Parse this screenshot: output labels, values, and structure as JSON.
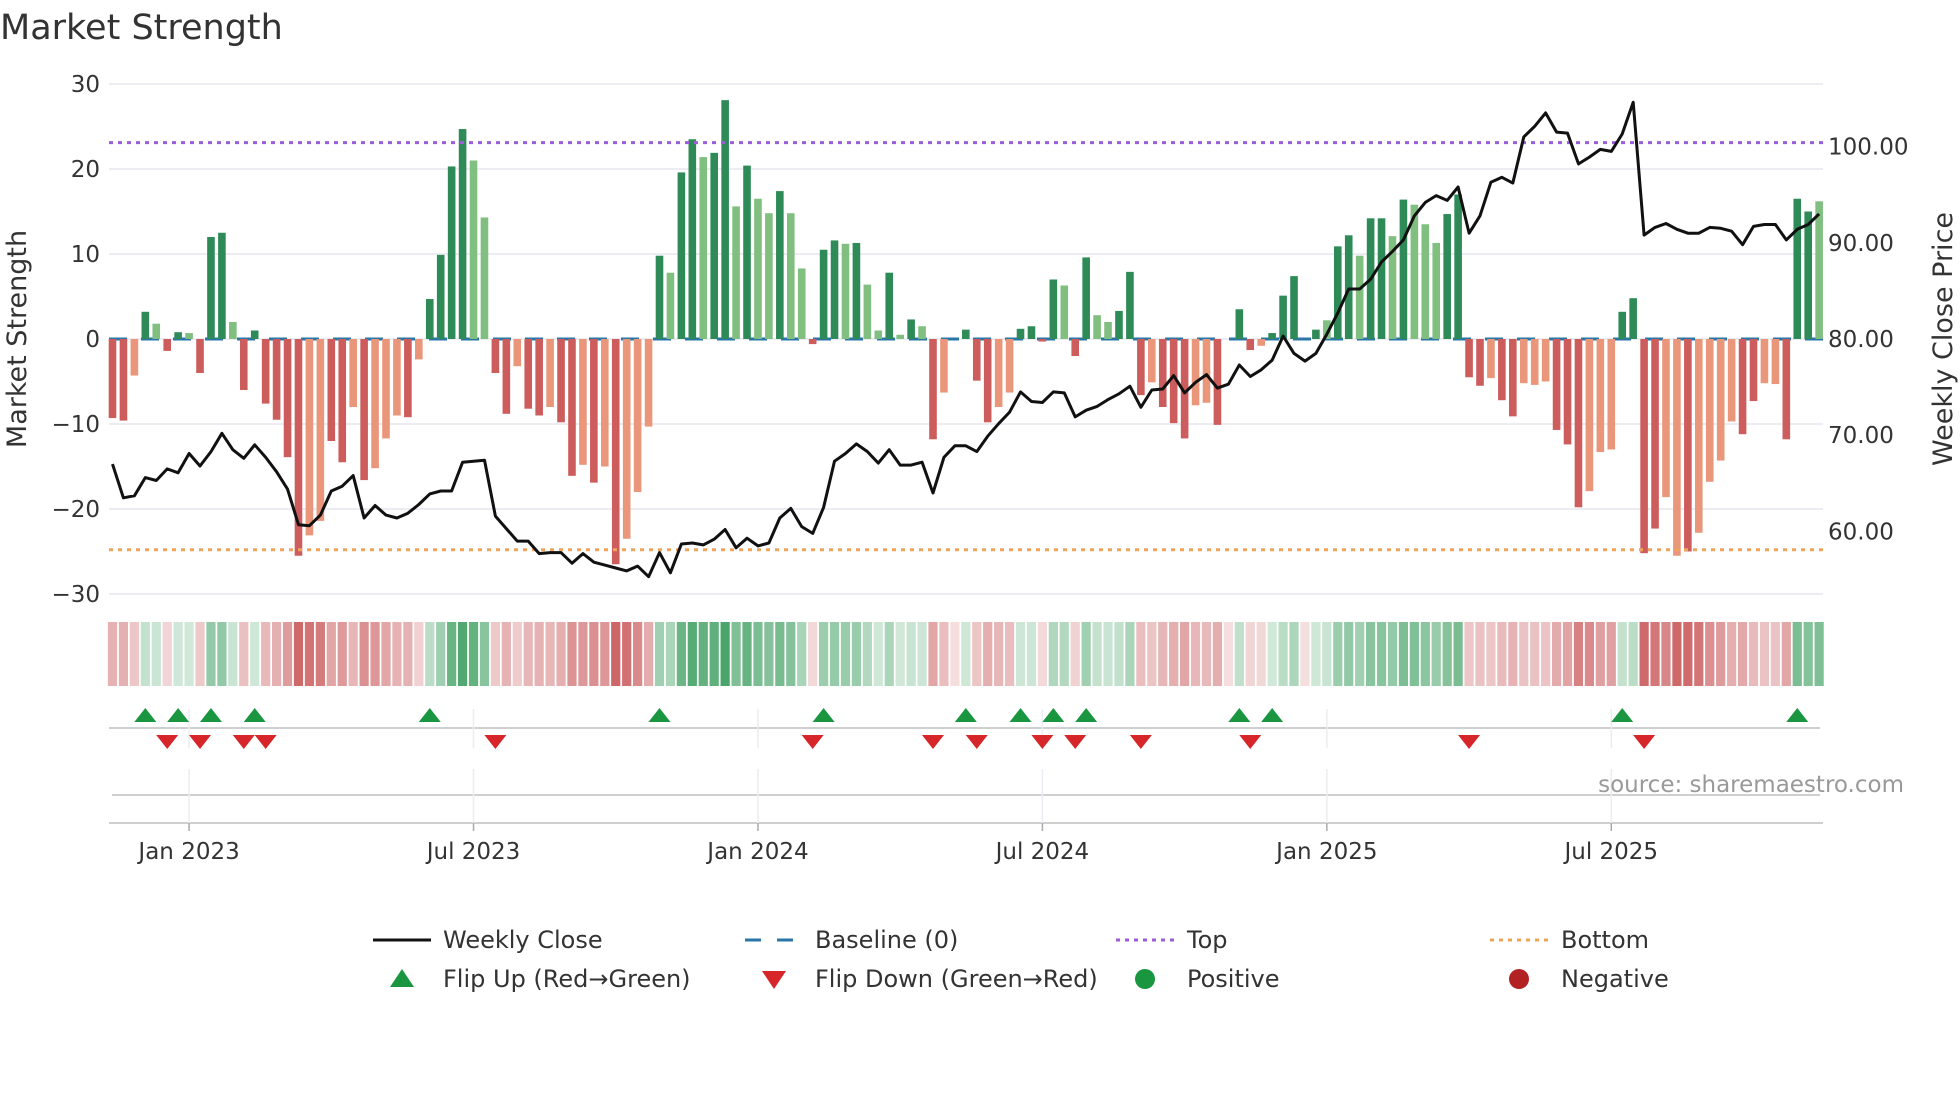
{
  "chart_data": {
    "type": "bar",
    "title": "Market Strength",
    "ylabel": "Market Strength",
    "y2label": "Weekly Close Price",
    "ylim": [
      -30,
      30
    ],
    "y2lim": [
      53.5,
      106.5
    ],
    "yticks": [
      "30",
      "20",
      "10",
      "0",
      "−10",
      "−20",
      "−30"
    ],
    "ytick_values": [
      30,
      20,
      10,
      0,
      -10,
      -20,
      -30
    ],
    "y2ticks": [
      "100.00",
      "90.00",
      "80.00",
      "70.00",
      "60.00"
    ],
    "y2tick_values": [
      100,
      90,
      80,
      70,
      60
    ],
    "xticks": [
      "Jan 2023",
      "Jul 2023",
      "Jan 2024",
      "Jul 2024",
      "Jan 2025",
      "Jul 2025"
    ],
    "xtick_week_index": [
      7,
      33,
      59,
      85,
      111,
      137
    ],
    "top_level": 23.1,
    "bottom_level": -24.8,
    "baseline": 0,
    "source": "source: sharemaestro.com",
    "strength": [
      -9.3,
      -9.6,
      -4.3,
      3.2,
      1.8,
      -1.4,
      0.8,
      0.7,
      -4,
      12,
      12.5,
      2,
      -6,
      1,
      -7.6,
      -9.5,
      -13.9,
      -25.5,
      -23.1,
      -21.4,
      -12,
      -14.5,
      -8,
      -16.6,
      -15.2,
      -11.7,
      -9,
      -9.2,
      -2.4,
      4.7,
      9.9,
      20.3,
      24.7,
      21,
      14.3,
      -4,
      -8.8,
      -3.2,
      -8.2,
      -9,
      -8,
      -9.8,
      -16.1,
      -14.8,
      -16.9,
      -15,
      -26.5,
      -23.5,
      -18,
      -10.3,
      9.8,
      7.8,
      19.6,
      23.5,
      21.4,
      21.9,
      28.1,
      15.6,
      20.4,
      16.5,
      14.8,
      17.4,
      14.8,
      8.3,
      -0.6,
      10.5,
      11.6,
      11.2,
      11.3,
      6.4,
      1,
      7.8,
      0.5,
      2.3,
      1.5,
      -11.8,
      -6.3,
      0,
      1.1,
      -4.9,
      -9.8,
      -8,
      -6.3,
      1.2,
      1.5,
      -0.3,
      7,
      6.3,
      -2,
      9.6,
      2.8,
      2,
      3.3,
      7.9,
      -6.6,
      -5.1,
      -8,
      -9.9,
      -11.7,
      -7.8,
      -7.5,
      -10.1,
      0,
      3.5,
      -1.3,
      -0.8,
      0.7,
      5.1,
      7.4,
      0,
      1.1,
      2.2,
      10.9,
      12.2,
      9.8,
      14.2,
      14.2,
      12.1,
      16.4,
      15.8,
      13.5,
      11.3,
      14.7,
      17,
      -4.5,
      -5.5,
      -4.6,
      -7.2,
      -9.1,
      -5.2,
      -5.4,
      -5,
      -10.7,
      -12.4,
      -19.8,
      -17.9,
      -13.3,
      -13,
      3.2,
      4.8,
      -25.2,
      -22.3,
      -18.6,
      -25.5,
      -25,
      -22.8,
      -16.8,
      -14.3,
      -9.7,
      -11.2,
      -7.3,
      -5.2,
      -5.3,
      -11.8,
      16.5,
      15,
      16.2
    ],
    "tones": "DDLDLDDLDDDLDDDDDDLLDDLDLLLDLDDDDLLDDLDDLDDLDLDLLLDLDDLDDLDLLDLLDDDLDLLDLDLDLZDDDLLDDDDLDDLLDDDLDDDLLDZDDLDDDZDLDDLDDLDLLLDDDDLDDLLLDDDLLLDDDDLLDLLLLDDLLDDDLD",
    "weekly_close": [
      67.0,
      63.5,
      63.7,
      65.6,
      65.3,
      66.5,
      66.1,
      68.1,
      66.8,
      68.3,
      70.2,
      68.5,
      67.6,
      69.0,
      67.7,
      66.2,
      64.4,
      60.7,
      60.6,
      61.7,
      64.2,
      64.7,
      65.8,
      61.4,
      62.7,
      61.7,
      61.4,
      61.9,
      62.8,
      63.9,
      64.2,
      64.2,
      67.2,
      67.3,
      67.4,
      61.6,
      60.3,
      59.0,
      59.0,
      57.7,
      57.8,
      57.8,
      56.7,
      57.7,
      56.8,
      56.5,
      56.2,
      55.9,
      56.4,
      55.3,
      57.8,
      55.7,
      58.7,
      58.8,
      58.6,
      59.2,
      60.2,
      58.3,
      59.3,
      58.5,
      58.8,
      61.4,
      62.4,
      60.5,
      59.8,
      62.5,
      67.3,
      68.1,
      69.1,
      68.3,
      67.1,
      68.5,
      66.9,
      66.9,
      67.2,
      64.0,
      67.7,
      68.9,
      68.9,
      68.3,
      69.9,
      71.2,
      72.4,
      74.5,
      73.5,
      73.4,
      74.5,
      74.4,
      71.9,
      72.6,
      73.0,
      73.7,
      74.3,
      75.1,
      72.9,
      74.7,
      74.8,
      76.2,
      74.4,
      75.5,
      76.3,
      74.9,
      75.3,
      77.3,
      76.1,
      76.8,
      77.8,
      80.3,
      78.5,
      77.7,
      78.5,
      80.5,
      82.7,
      85.2,
      85.2,
      86.2,
      88.0,
      89.1,
      90.3,
      92.8,
      94.2,
      94.9,
      94.4,
      95.8,
      91.0,
      92.8,
      96.3,
      96.8,
      96.2,
      101.0,
      102.1,
      103.5,
      101.5,
      101.4,
      98.2,
      98.9,
      99.7,
      99.5,
      101.3,
      104.6,
      90.8,
      91.6,
      92.0,
      91.4,
      91.0,
      91.0,
      91.6,
      91.5,
      91.2,
      89.8,
      91.7,
      91.9,
      91.9,
      90.3,
      91.4,
      91.9,
      93.0
    ],
    "flip_up_weeks": [
      3,
      6,
      9,
      13,
      29,
      50,
      65,
      78,
      83,
      86,
      89,
      103,
      106,
      138,
      154
    ],
    "flip_down_weeks": [
      5,
      8,
      12,
      14,
      35,
      64,
      75,
      79,
      85,
      88,
      94,
      104,
      124,
      140
    ],
    "legend": [
      {
        "label": "Weekly Close",
        "symbol": "line"
      },
      {
        "label": "Baseline (0)",
        "symbol": "dash"
      },
      {
        "label": "Top",
        "symbol": "dot-purple"
      },
      {
        "label": "Bottom",
        "symbol": "dot-orange"
      },
      {
        "label": "Flip Up (Red→Green)",
        "symbol": "triangle-up"
      },
      {
        "label": "Flip Down (Green→Red)",
        "symbol": "triangle-down"
      },
      {
        "label": "Positive",
        "symbol": "circle-green"
      },
      {
        "label": "Negative",
        "symbol": "circle-red"
      }
    ],
    "legend_position": "bottom-center",
    "colors": {
      "pos_dark": "#2e8b57",
      "pos_light": "#80bf80",
      "neg_dark": "#cd5c5c",
      "neg_light": "#e9967a",
      "line": "#111111",
      "baseline": "#2a75a8",
      "top": "#9a5fd6",
      "bottom": "#f0a45a",
      "flip_up": "#1a9641",
      "flip_down": "#d7262a",
      "positive": "#1a9641",
      "negative": "#b22222",
      "grid": "#ececf2"
    }
  }
}
